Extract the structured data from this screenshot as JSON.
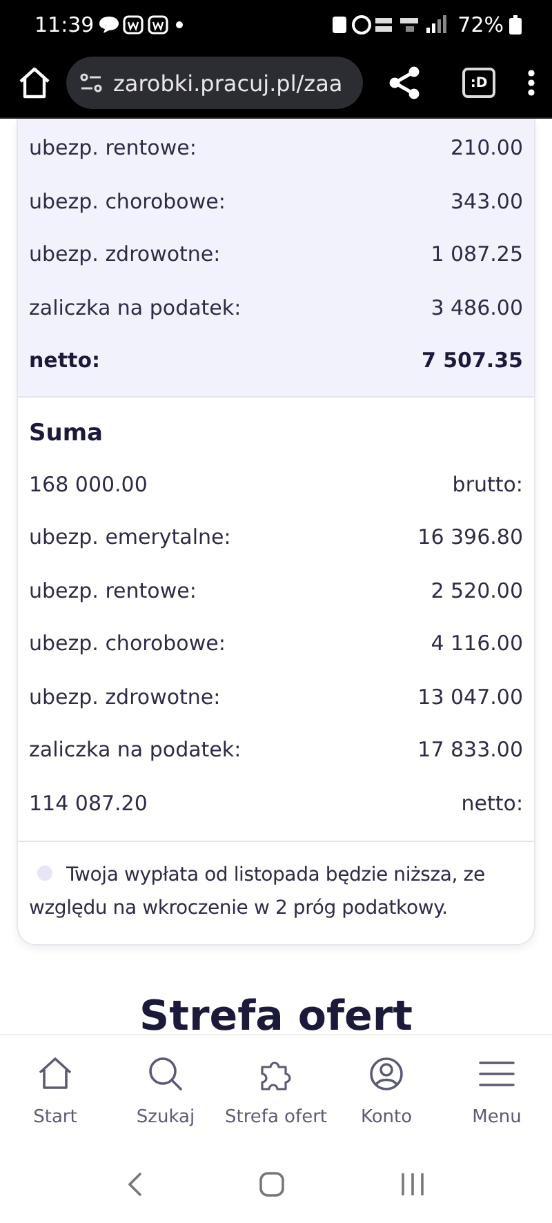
{
  "status_bar": {
    "time": "11:39",
    "battery": "72%"
  },
  "browser": {
    "url": "zarobki.pracuj.pl/zaa",
    "tab_label": ":D"
  },
  "monthly": {
    "rows": [
      {
        "label": "ubezp. rentowe:",
        "value": "210.00",
        "bold": false
      },
      {
        "label": "ubezp. chorobowe:",
        "value": "343.00",
        "bold": false
      },
      {
        "label": "ubezp. zdrowotne:",
        "value": "1 087.25",
        "bold": false
      },
      {
        "label": "zaliczka na podatek:",
        "value": "3 486.00",
        "bold": false
      },
      {
        "label": "netto:",
        "value": "7 507.35",
        "bold": true
      }
    ]
  },
  "sum": {
    "title": "Suma",
    "rows": [
      {
        "left": "168 000.00",
        "right": "brutto:"
      },
      {
        "left": "ubezp. emerytalne:",
        "right": "16 396.80"
      },
      {
        "left": "ubezp. rentowe:",
        "right": "2 520.00"
      },
      {
        "left": "ubezp. chorobowe:",
        "right": "4 116.00"
      },
      {
        "left": "ubezp. zdrowotne:",
        "right": "13 047.00"
      },
      {
        "left": "zaliczka na podatek:",
        "right": "17 833.00"
      },
      {
        "left": "114 087.20",
        "right": "netto:"
      }
    ]
  },
  "note": "Twoja wypłata od listopada będzie niższa, ze względu na wkroczenie w 2 próg podatkowy.",
  "section_heading": "Strefa ofert",
  "bottom_nav": [
    {
      "kind": "home",
      "label": "Start"
    },
    {
      "kind": "search",
      "label": "Szukaj"
    },
    {
      "kind": "puzzle",
      "label": "Strefa ofert"
    },
    {
      "kind": "account",
      "label": "Konto"
    },
    {
      "kind": "menu",
      "label": "Menu"
    }
  ]
}
